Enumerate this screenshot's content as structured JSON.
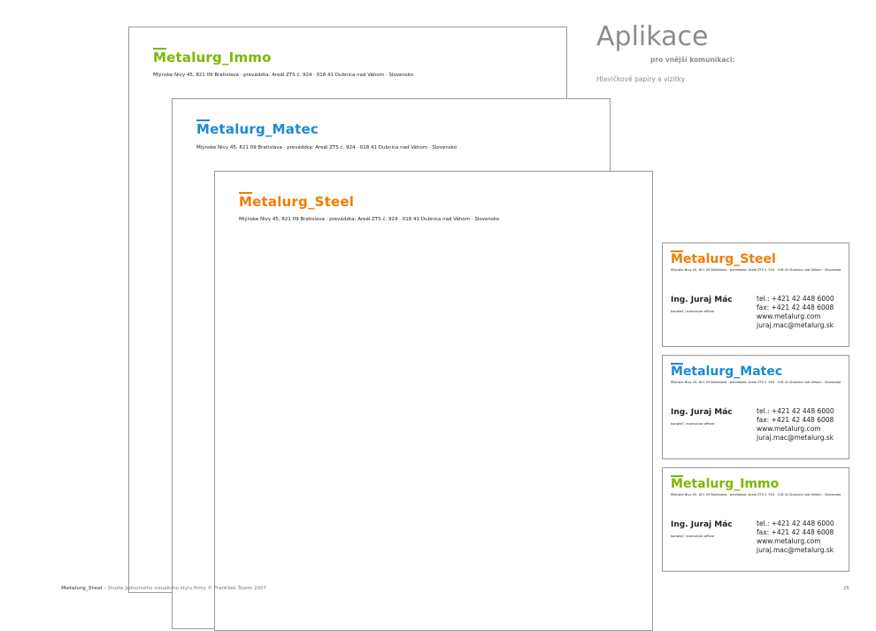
{
  "header": {
    "title": "Aplikace",
    "subtitle": "pro vnější komunikaci:",
    "section": "Hlavičkové papíry a vizitky"
  },
  "colors": {
    "immo": "#7ab800",
    "matec": "#1a8ad6",
    "steel": "#f07d00",
    "border": "#9a9a9a",
    "gray_text": "#8c8c8c"
  },
  "letterheads": [
    {
      "logo_m": "M",
      "logo_rest": "etalurg_Immo",
      "address": "Mlýnske Nivy 45, 821 09 Bratislava · prevádzka: Areál ZTS č. 924 · 018 41 Dubnica nad Váhom · Slovensko"
    },
    {
      "logo_m": "M",
      "logo_rest": "etalurg_Matec",
      "address": "Mlýnske Nivy 45, 821 09 Bratislava · prevádzka: Areál ZTS č. 924 · 018 41 Dubnica nad Váhom · Slovensko"
    },
    {
      "logo_m": "M",
      "logo_rest": "etalurg_Steel",
      "address": "Mlýnske Nivy 45, 821 09 Bratislava · prevádzka: Areál ZTS č. 924 · 018 41 Dubnica nad Váhom · Slovensko"
    }
  ],
  "cards": [
    {
      "logo_m": "M",
      "logo_rest": "etalurg_Steel",
      "address": "Mlýnske Nivy 45, 821 09 Bratislava · prevádzka: Areál ZTS č. 924 · 018 41 Dubnica nad Váhom · Slovensko",
      "name": "Ing. Juraj Mác",
      "role": "konateľ / executive officer",
      "tel": "tel.: +421 42 448 6000",
      "fax": "fax: +421 42 448 6008",
      "web": "www.metalurg.com",
      "email": "juraj.mac@metalurg.sk"
    },
    {
      "logo_m": "M",
      "logo_rest": "etalurg_Matec",
      "address": "Mlýnske Nivy 45, 821 09 Bratislava · prevádzka: Areál ZTS č. 924 · 018 41 Dubnica nad Váhom · Slovensko",
      "name": "Ing. Juraj Mác",
      "role": "konateľ / executive officer",
      "tel": "tel.: +421 42 448 6000",
      "fax": "fax: +421 42 448 6008",
      "web": "www.metalurg.com",
      "email": "juraj.mac@metalurg.sk"
    },
    {
      "logo_m": "M",
      "logo_rest": "etalurg_Immo",
      "address": "Mlýnske Nivy 45, 821 09 Bratislava · prevádzka: Areál ZTS č. 924 · 018 41 Dubnica nad Váhom · Slovensko",
      "name": "Ing. Juraj Mác",
      "role": "konateľ / executive officer",
      "tel": "tel.: +421 42 448 6000",
      "fax": "fax: +421 42 448 6008",
      "web": "www.metalurg.com",
      "email": "juraj.mac@metalurg.sk"
    }
  ],
  "footer": {
    "brand": "Metalurg_Steel",
    "text": " – Studie jednotného vizuálního stylu firmy © František Štorm 2007",
    "page": "26"
  }
}
